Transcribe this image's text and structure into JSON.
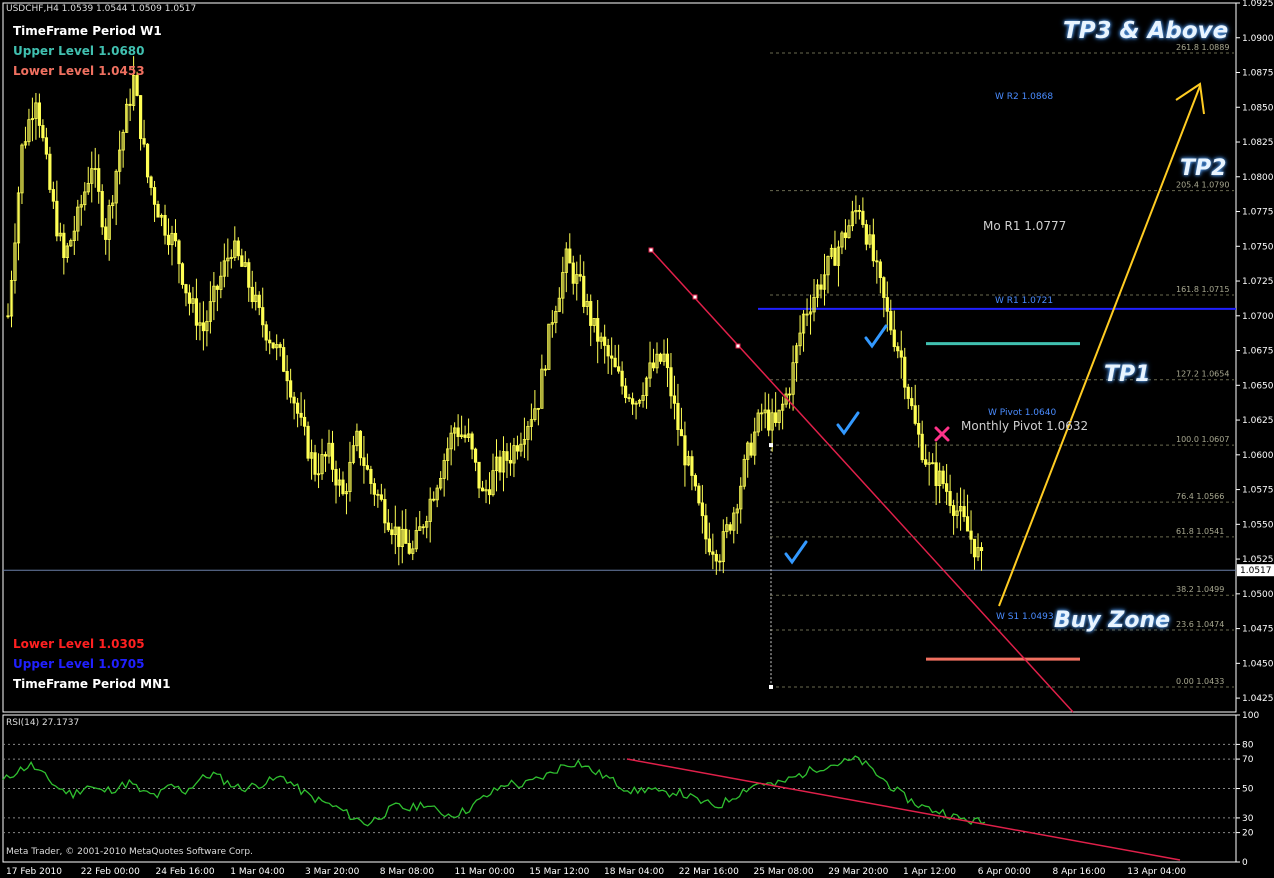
{
  "header": {
    "symbol_line": "USDCHF,H4  1.0539 1.0544 1.0509 1.0517",
    "tf_w1": "TimeFrame Period W1",
    "upper_w1": "Upper Level 1.0680",
    "lower_w1": "Lower Level 1.0453",
    "lower_mn1": "Lower Level 1.0305",
    "upper_mn1": "Upper Level 1.0705",
    "tf_mn1": "TimeFrame Period MN1",
    "copyright": "Meta Trader, © 2001-2010 MetaQuotes Software Corp.",
    "rsi_label": "RSI(14) 27.1737"
  },
  "annotations": {
    "tp3": "TP3 & Above",
    "tp2": "TP2",
    "tp1": "TP1",
    "buy_zone": "Buy Zone",
    "mo_r1": "Mo R1 1.0777",
    "monthly_pivot": "Monthly Pivot 1.0632",
    "w_r2": "W R2 1.0868",
    "w_r1": "W R1 1.0721",
    "w_pivot": "W Pivot 1.0640",
    "w_s1": "W S1 1.0493"
  },
  "colors": {
    "background": "#000000",
    "candles": "#ffff55",
    "upper_w1": "#40c0b0",
    "lower_w1": "#f07060",
    "lower_mn1": "#ff2020",
    "upper_mn1": "#2020ff",
    "trendline": "#e0204a",
    "arrow": "#ffcc22",
    "rsi_line": "#30c030",
    "fib_text": "#a8a890",
    "pivot_text": "#4a8cff",
    "checkmark": "#3399ff",
    "cross": "#ff3388"
  },
  "chart_data": {
    "type": "candlestick",
    "symbol": "USDCHF",
    "timeframe": "H4",
    "ohlc_current": {
      "open": 1.0539,
      "high": 1.0544,
      "low": 1.0509,
      "close": 1.0517
    },
    "y_range": [
      1.0415,
      1.0925
    ],
    "y_ticks": [
      "1.0925",
      "1.0900",
      "1.0875",
      "1.0850",
      "1.0825",
      "1.0800",
      "1.0775",
      "1.0750",
      "1.0725",
      "1.0700",
      "1.0675",
      "1.0650",
      "1.0625",
      "1.0600",
      "1.0575",
      "1.0550",
      "1.0525",
      "1.0500",
      "1.0475",
      "1.0450",
      "1.0425"
    ],
    "current_price_label": "1.0517",
    "x_ticks": [
      "17 Feb 2010",
      "22 Feb 00:00",
      "24 Feb 16:00",
      "1 Mar 04:00",
      "3 Mar 20:00",
      "8 Mar 08:00",
      "11 Mar 00:00",
      "15 Mar 12:00",
      "18 Mar 04:00",
      "22 Mar 16:00",
      "25 Mar 08:00",
      "29 Mar 20:00",
      "1 Apr 12:00",
      "6 Apr 00:00",
      "8 Apr 16:00",
      "13 Apr 04:00"
    ],
    "close_series": [
      1.07,
      1.082,
      1.086,
      1.079,
      1.074,
      1.077,
      1.081,
      1.076,
      1.082,
      1.087,
      1.08,
      1.077,
      1.075,
      1.071,
      1.069,
      1.072,
      1.075,
      1.073,
      1.07,
      1.068,
      1.066,
      1.062,
      1.059,
      1.06,
      1.057,
      1.061,
      1.058,
      1.056,
      1.054,
      1.053,
      1.056,
      1.059,
      1.062,
      1.061,
      1.057,
      1.059,
      1.06,
      1.062,
      1.064,
      1.07,
      1.074,
      1.072,
      1.069,
      1.067,
      1.065,
      1.064,
      1.066,
      1.067,
      1.062,
      1.058,
      1.054,
      1.053,
      1.056,
      1.06,
      1.063,
      1.062,
      1.065,
      1.07,
      1.072,
      1.074,
      1.076,
      1.078,
      1.074,
      1.07,
      1.067,
      1.062,
      1.059,
      1.058,
      1.056,
      1.054,
      1.0517
    ],
    "fibonacci": [
      {
        "level": "261.8",
        "price": 1.0889
      },
      {
        "level": "205.4",
        "price": 1.079
      },
      {
        "level": "161.8",
        "price": 1.0715
      },
      {
        "level": "127.2",
        "price": 1.0654
      },
      {
        "level": "100.0",
        "price": 1.0607
      },
      {
        "level": "76.4",
        "price": 1.0566
      },
      {
        "level": "61.8",
        "price": 1.0541
      },
      {
        "level": "38.2",
        "price": 1.0499
      },
      {
        "level": "23.6",
        "price": 1.0474
      },
      {
        "level": "0.00",
        "price": 1.0433
      }
    ],
    "levels": {
      "upper_mn1": 1.0705,
      "upper_w1": 1.068,
      "lower_w1": 1.0453,
      "w_r2": 1.0868,
      "w_r1": 1.0721,
      "w_pivot": 1.064,
      "w_s1": 1.0493,
      "mo_r1": 1.0777,
      "monthly_pivot": 1.0632
    },
    "rsi": {
      "period": 14,
      "value": 27.1737,
      "range": [
        0,
        100
      ],
      "ticks": [
        "100",
        "80",
        "70",
        "50",
        "30",
        "20",
        "0"
      ],
      "levels": [
        30,
        70
      ],
      "series": [
        55,
        62,
        66,
        58,
        50,
        46,
        52,
        48,
        50,
        54,
        47,
        45,
        52,
        48,
        56,
        60,
        54,
        50,
        52,
        55,
        58,
        50,
        44,
        40,
        36,
        30,
        26,
        32,
        38,
        36,
        40,
        34,
        32,
        35,
        42,
        48,
        54,
        52,
        56,
        60,
        66,
        68,
        62,
        58,
        52,
        48,
        50,
        46,
        48,
        44,
        40,
        38,
        44,
        50,
        54,
        52,
        56,
        60,
        64,
        66,
        68,
        70,
        62,
        54,
        46,
        40,
        36,
        34,
        30,
        28,
        27
      ]
    }
  }
}
